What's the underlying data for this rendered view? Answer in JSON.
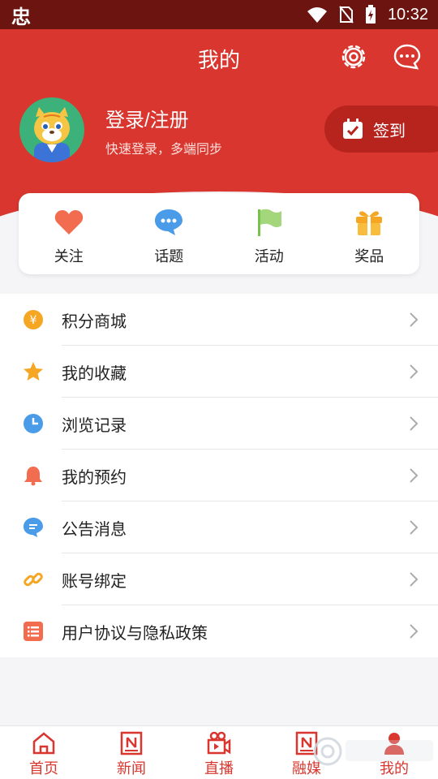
{
  "status_bar": {
    "app_glyph": "忠",
    "time": "10:32"
  },
  "header": {
    "title": "我的"
  },
  "profile": {
    "login_text": "登录/注册",
    "subtitle": "快速登录，多端同步",
    "checkin_label": "签到"
  },
  "quick_actions": [
    {
      "label": "关注",
      "icon": "heart-icon",
      "color": "#f26d4f"
    },
    {
      "label": "话题",
      "icon": "chat-bubble-icon",
      "color": "#4a9be8"
    },
    {
      "label": "活动",
      "icon": "flag-icon",
      "color": "#79c14b"
    },
    {
      "label": "奖品",
      "icon": "gift-icon",
      "color": "#f5a623"
    }
  ],
  "menu": [
    {
      "label": "积分商城",
      "icon": "coin-icon",
      "color": "#f5a623"
    },
    {
      "label": "我的收藏",
      "icon": "star-icon",
      "color": "#f5a623"
    },
    {
      "label": "浏览记录",
      "icon": "clock-icon",
      "color": "#4a9be8"
    },
    {
      "label": "我的预约",
      "icon": "bell-icon",
      "color": "#f26d4f"
    },
    {
      "label": "公告消息",
      "icon": "message-icon",
      "color": "#4a9be8"
    },
    {
      "label": "账号绑定",
      "icon": "link-icon",
      "color": "#f5a623"
    },
    {
      "label": "用户协议与隐私政策",
      "icon": "list-icon",
      "color": "#f26d4f"
    }
  ],
  "bottom_nav": [
    {
      "label": "首页",
      "icon": "home-icon"
    },
    {
      "label": "新闻",
      "icon": "news-icon"
    },
    {
      "label": "直播",
      "icon": "video-camera-icon"
    },
    {
      "label": "融媒",
      "icon": "media-icon"
    },
    {
      "label": "我的",
      "icon": "profile-icon"
    }
  ],
  "colors": {
    "primary": "#d8362e",
    "status_bar": "#6b1410",
    "checkin": "#b7231d"
  }
}
